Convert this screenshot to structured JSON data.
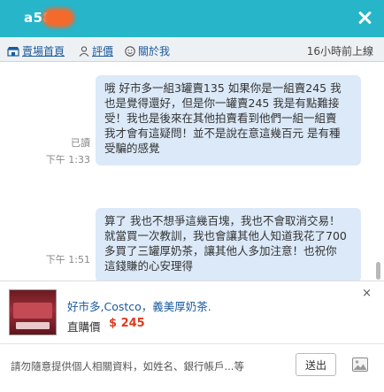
{
  "window": {
    "title": "a58",
    "close_icon": "close-icon"
  },
  "nav": {
    "home": "賣場首頁",
    "reviews": "評價",
    "about": "關於我",
    "status": "16小時前上線"
  },
  "messages": [
    {
      "lines": [
        "哦 好市多一組3罐賣135 如果你是一組賣245 我",
        "也是覺得還好，但是你一罐賣245 我是有點難接",
        "受！我也是後來在其他拍賣看到他們一組一組賣",
        "我才會有這疑問！並不是說在意這幾百元 是有種",
        "受騙的感覺"
      ],
      "read": "已讀",
      "time": "下午 1:33"
    },
    {
      "lines": [
        "算了 我也不想爭這幾百塊，我也不會取消交易！",
        "就當買一次教訓，我也會讓其他人知道我花了700",
        "多買了三罐厚奶茶，讓其他人多加注意！也祝你",
        "這錢賺的心安理得"
      ],
      "time": "下午 1:51"
    }
  ],
  "product": {
    "title": "好市多,Costco，義美厚奶茶.",
    "price_label": "直購價",
    "price": "$ 245",
    "close": "×"
  },
  "composer": {
    "placeholder": "請勿隨意提供個人相關資料，如姓名、銀行帳戶...等",
    "send": "送出"
  },
  "colors": {
    "header": "#27b5c9",
    "bubble": "#dbe9f8",
    "price": "#e03a1e",
    "link": "#1a5a9c"
  }
}
